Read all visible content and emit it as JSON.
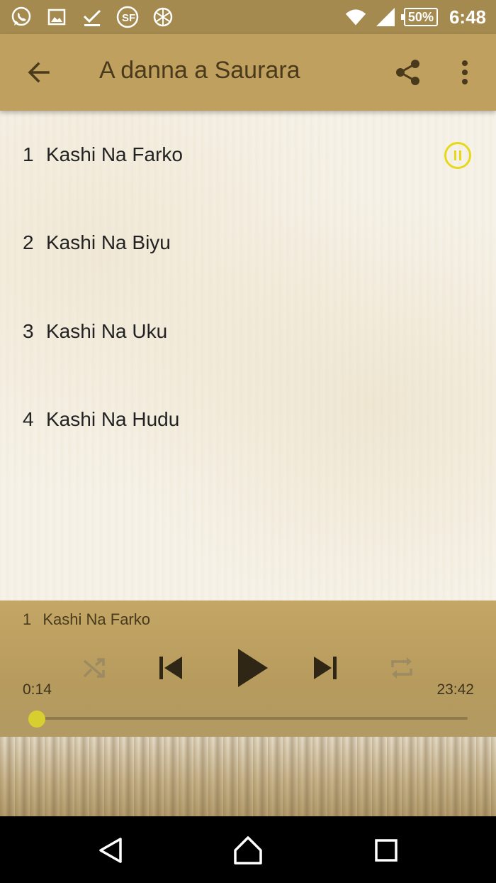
{
  "status_bar": {
    "battery": "50%",
    "time": "6:48",
    "left_icons": [
      "whatsapp-icon",
      "image-icon",
      "download-done-icon",
      "sf-app-icon",
      "globe-icon"
    ],
    "right_icons": [
      "wifi-icon",
      "signal-icon"
    ]
  },
  "app_bar": {
    "title": "A danna a Saurara",
    "back_icon": "arrow-left-icon",
    "share_icon": "share-icon",
    "more_icon": "more-vert-icon",
    "color": "#c0a05f"
  },
  "tracks": [
    {
      "number": "1",
      "title": "Kashi Na Farko",
      "playing": true
    },
    {
      "number": "2",
      "title": "Kashi Na Biyu",
      "playing": false
    },
    {
      "number": "3",
      "title": "Kashi Na Uku",
      "playing": false
    },
    {
      "number": "4",
      "title": "Kashi Na Hudu",
      "playing": false
    }
  ],
  "player": {
    "now_playing_number": "1",
    "now_playing_title": "Kashi Na Farko",
    "elapsed": "0:14",
    "duration": "23:42",
    "progress_fraction": 0.01,
    "controls": [
      "shuffle-icon",
      "skip-previous-icon",
      "play-icon",
      "skip-next-icon",
      "repeat-icon"
    ],
    "accent": "#d7cf2f"
  },
  "nav_bar": {
    "buttons": [
      "back-triangle-icon",
      "home-icon",
      "recents-icon"
    ]
  }
}
